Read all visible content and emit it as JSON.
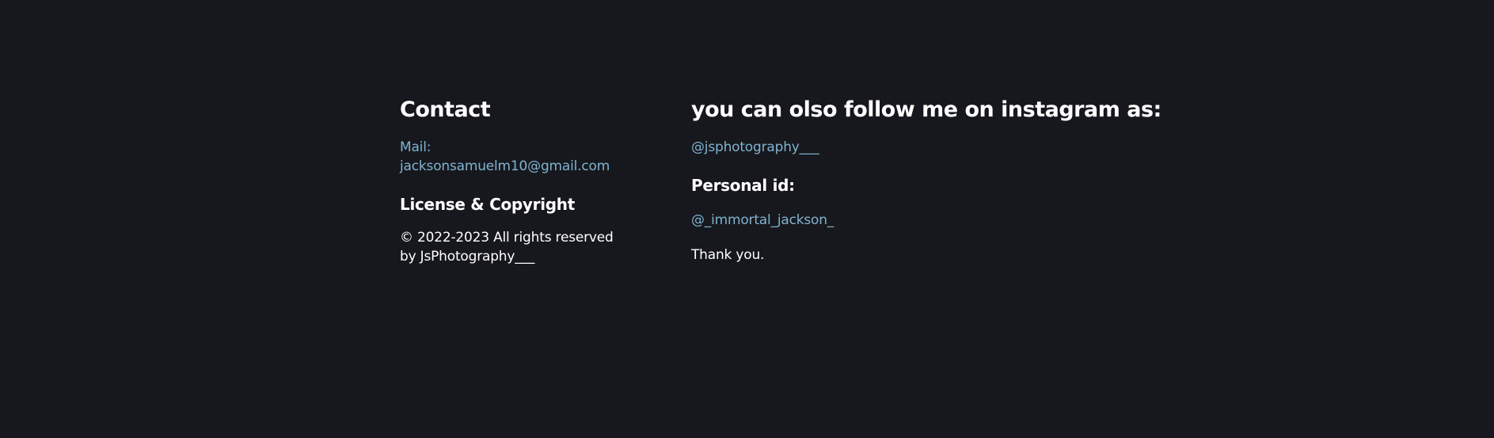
{
  "contact": {
    "heading": "Contact",
    "mail_label": "Mail:",
    "mail_address": "jacksonsamuelm10@gmail.com"
  },
  "license": {
    "heading": "License & Copyright",
    "line1": "© 2022-2023 All rights reserved",
    "line2": "by JsPhotography___"
  },
  "instagram": {
    "heading": "you can olso follow me on instagram as:",
    "handle": "@jsphotography___",
    "personal_heading": "Personal id:",
    "personal_handle": "@_immortal_jackson_",
    "thanks": "Thank you."
  },
  "colors": {
    "background": "#17181d",
    "text": "#ffffff",
    "link": "#7fb3d1"
  }
}
